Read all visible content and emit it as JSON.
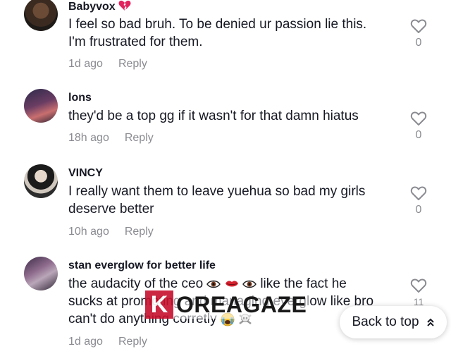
{
  "comments": [
    {
      "username": "Babyvox",
      "username_emoji": "broken-heart-icon",
      "line1": "I feel so bad bruh. To be denied ur passion lie this.",
      "line2": "I'm frustrated for them.",
      "time": "1d ago",
      "reply": "Reply",
      "likes": "0"
    },
    {
      "username": "lons",
      "line1": "they'd be a top gg if it wasn't for that damn hiatus",
      "time": "18h ago",
      "reply": "Reply",
      "likes": "0"
    },
    {
      "username": "VINCY",
      "line1": "I really want them to leave yuehua so bad my girls",
      "line2": "deserve better",
      "time": "10h ago",
      "reply": "Reply",
      "likes": "0"
    },
    {
      "username": "stan everglow for better life",
      "line1_a": "the audacity of the ceo",
      "line1_emojis": [
        "eye-icon",
        "lips-icon",
        "eye-icon"
      ],
      "line1_b": "like the fact he",
      "line2": "sucks at promoting and managing everglow like bro",
      "line3": "can't do anything corretly",
      "line3_emojis": [
        "crying-face-icon",
        "skull-crossbones-icon"
      ],
      "time": "1d ago",
      "reply": "Reply",
      "likes": "11"
    }
  ],
  "back_to_top": {
    "label": "Back to top",
    "icon": "double-chevron-up-icon"
  },
  "watermark": {
    "letter": "K",
    "text": "OREAGAZE"
  },
  "colors": {
    "text": "#161823",
    "meta": "#8a8b91",
    "heart_emoji": "#e0245e",
    "watermark_red": "#c7102e"
  }
}
